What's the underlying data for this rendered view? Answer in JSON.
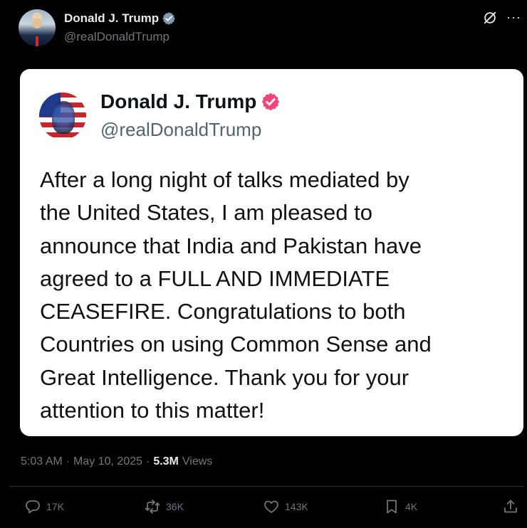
{
  "post": {
    "author_name": "Donald J. Trump",
    "author_handle": "@realDonaldTrump",
    "time": "5:03 AM",
    "separator": "·",
    "date": "May 10, 2025",
    "views_count": "5.3M",
    "views_label": "Views"
  },
  "card": {
    "author_name": "Donald J. Trump",
    "author_handle": "@realDonaldTrump",
    "text": "After a long night of talks mediated by\nthe United States, I am pleased to\nannounce that India and Pakistan have\nagreed to a FULL AND IMMEDIATE\nCEASEFIRE. Congratulations to both\nCountries on using Common Sense and\nGreat Intelligence. Thank you for your\nattention to this matter!"
  },
  "actions": {
    "replies": "17K",
    "reposts": "36K",
    "likes": "143K",
    "bookmarks": "4K"
  },
  "icons": {
    "verified": "verified-badge-icon",
    "grok": "grok-icon",
    "more": "more-icon",
    "reply": "reply-icon",
    "repost": "repost-icon",
    "like": "heart-icon",
    "bookmark": "bookmark-icon",
    "share": "share-icon"
  },
  "colors": {
    "background": "#000000",
    "text": "#e7e9ea",
    "muted": "#71767b",
    "verified_gray": "#829aab",
    "verified_pink": "#f0447a",
    "card_bg": "#ffffff"
  }
}
